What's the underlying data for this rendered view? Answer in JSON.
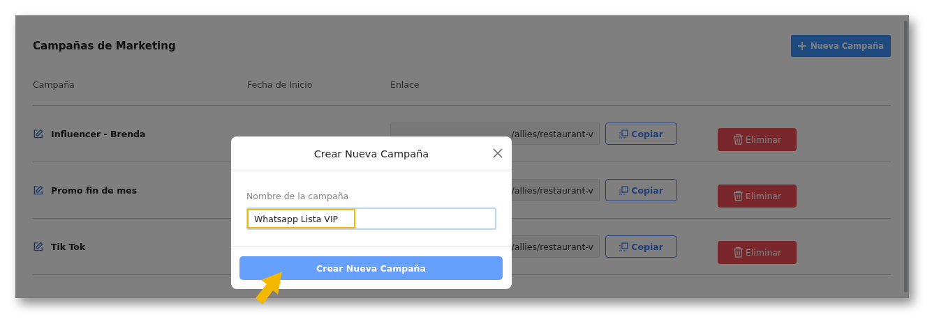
{
  "page": {
    "title": "Campañas de Marketing",
    "new_button": "Nueva Campaña",
    "columns": [
      "Campaña",
      "Fecha de Inicio",
      "Enlace"
    ],
    "rows": [
      {
        "name": "Influencer - Brenda",
        "link": "/allies/restaurant-v",
        "copy": "Copiar",
        "delete": "Eliminar"
      },
      {
        "name": "Promo fin de mes",
        "link": "/allies/restaurant-v",
        "copy": "Copiar",
        "delete": "Eliminar"
      },
      {
        "name": "Tik Tok",
        "link": "/allies/restaurant-v",
        "copy": "Copiar",
        "delete": "Eliminar"
      }
    ]
  },
  "modal": {
    "title": "Crear Nueva Campaña",
    "field_label": "Nombre de la campaña",
    "field_value": "Whatsapp Lista VIP",
    "submit": "Crear Nueva Campaña"
  }
}
